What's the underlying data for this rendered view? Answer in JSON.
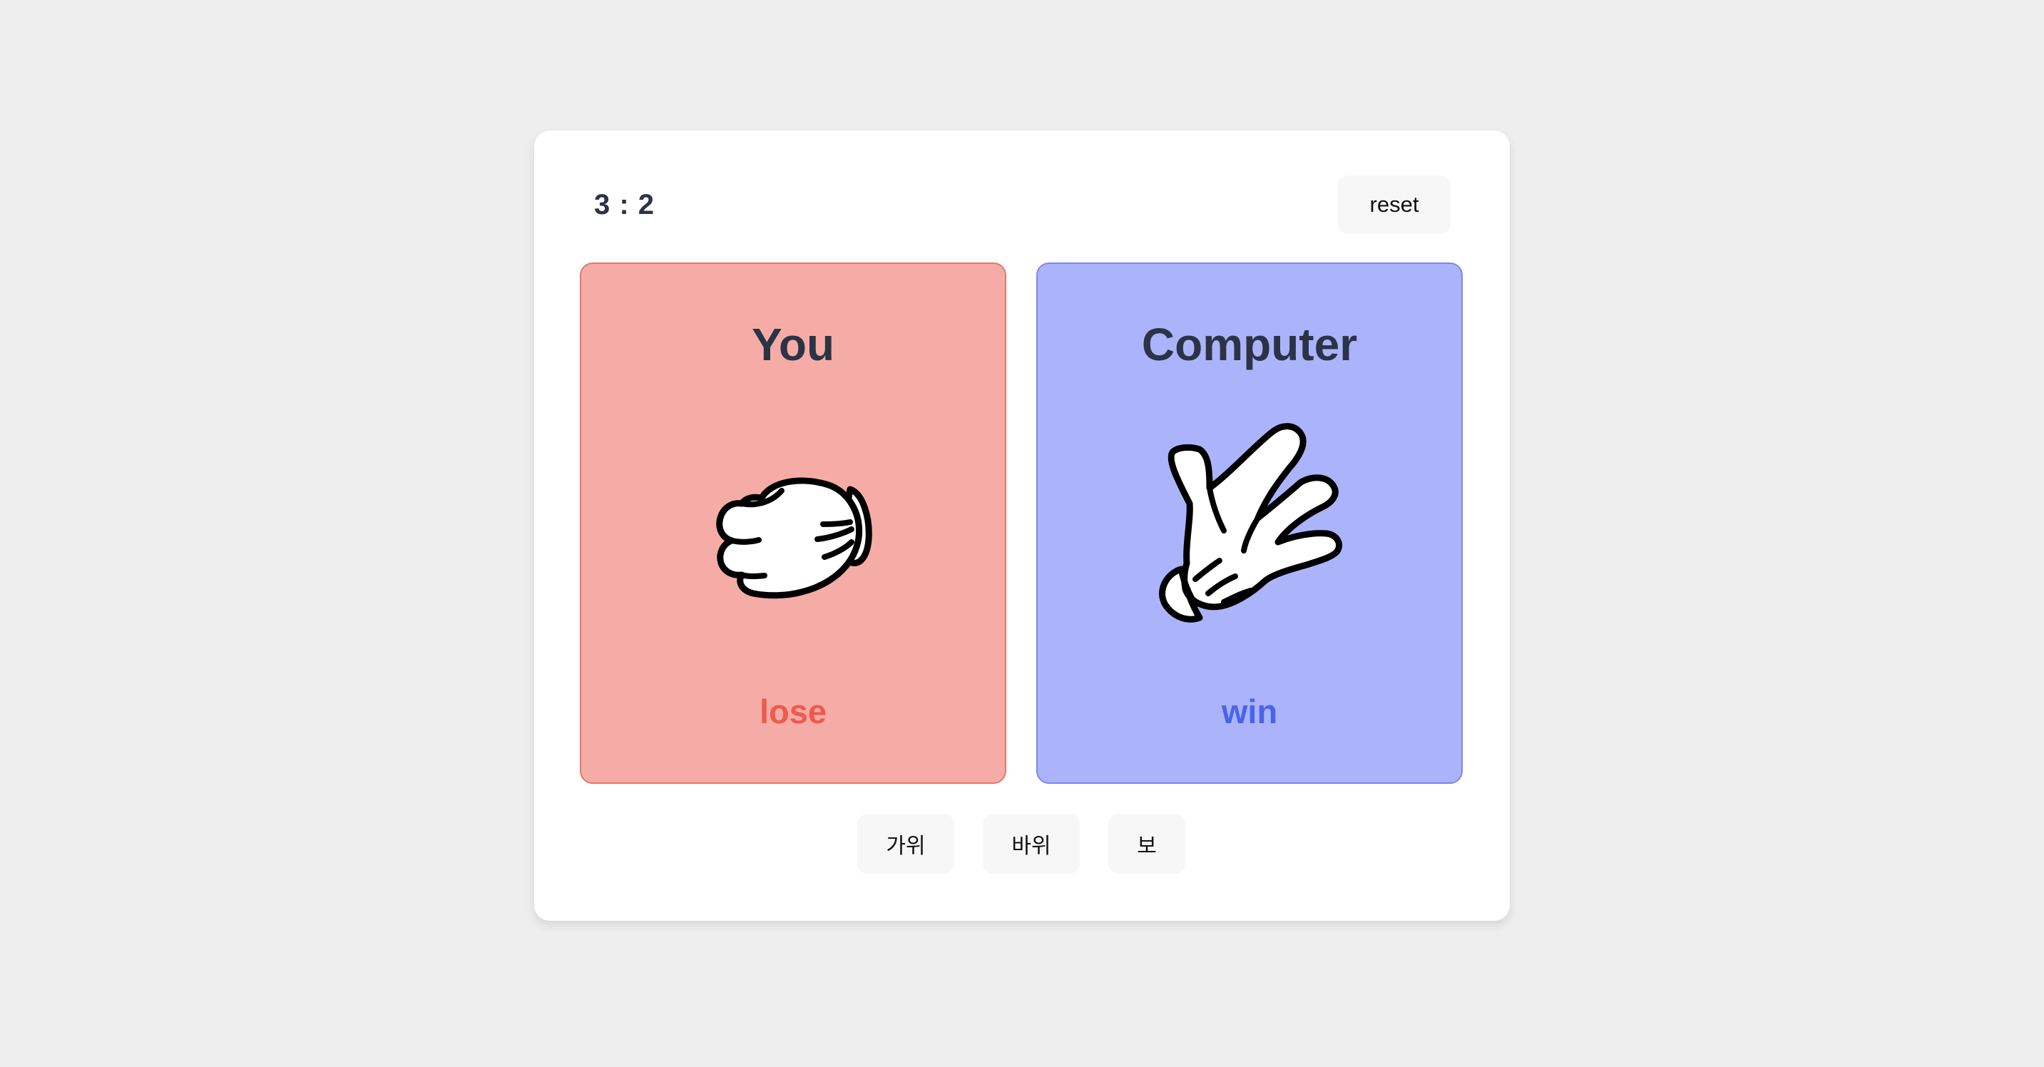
{
  "score": {
    "text": "3 : 2"
  },
  "reset": {
    "label": "reset"
  },
  "player": {
    "title": "You",
    "hand": "rock-hand-icon",
    "result": "lose",
    "result_color": "#ef5a4c",
    "card_bg": "#f6aca6",
    "card_border": "#e2786f"
  },
  "computer": {
    "title": "Computer",
    "hand": "scissors-hand-icon",
    "result": "win",
    "result_color": "#4a63ee",
    "card_bg": "#abb4fb",
    "card_border": "#7d88e3"
  },
  "choices": [
    {
      "label": "가위"
    },
    {
      "label": "바위"
    },
    {
      "label": "보"
    }
  ]
}
